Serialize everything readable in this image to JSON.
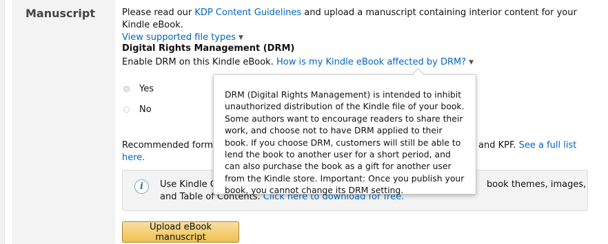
{
  "section": {
    "label": "Manuscript"
  },
  "intro": {
    "before": "Please read our ",
    "guidelines_link": "KDP Content Guidelines",
    "after": " and upload a manuscript containing interior content for your Kindle eBook.",
    "file_types_link": "View supported file types"
  },
  "drm": {
    "heading": "Digital Rights Management (DRM)",
    "enable_text": "Enable DRM on this Kindle eBook. ",
    "help_link": "How is my Kindle eBook affected by DRM?",
    "options": [
      {
        "label": "Yes",
        "selected": true
      },
      {
        "label": "No",
        "selected": false
      }
    ]
  },
  "formats": {
    "text_start": "Recommended formats",
    "text_end": " and KPF. ",
    "full_list_link_1": "See a full list",
    "full_list_link_2": "here."
  },
  "info": {
    "icon": "info-icon",
    "text_start": "Use Kindle Cre",
    "text_end": "book themes, images,",
    "line2_text": "and Table of Contents. ",
    "download_link": "Click here to download for free."
  },
  "upload_button": {
    "label": "Upload eBook manuscript"
  },
  "popover": {
    "text": "DRM (Digital Rights Management) is intended to inhibit unauthorized distribution of the Kindle file of your book. Some authors want to encourage readers to share their work, and choose not to have DRM applied to their book. If you choose DRM, customers will still be able to lend the book to another user for a short period, and can also purchase the book as a gift for another user from the Kindle store. Important: Once you publish your book, you cannot change its DRM setting."
  },
  "colors": {
    "link": "#0066c0",
    "button_top": "#f7dfa5",
    "button_bottom": "#f0c14b",
    "sidebar": "#f3f3f3"
  }
}
